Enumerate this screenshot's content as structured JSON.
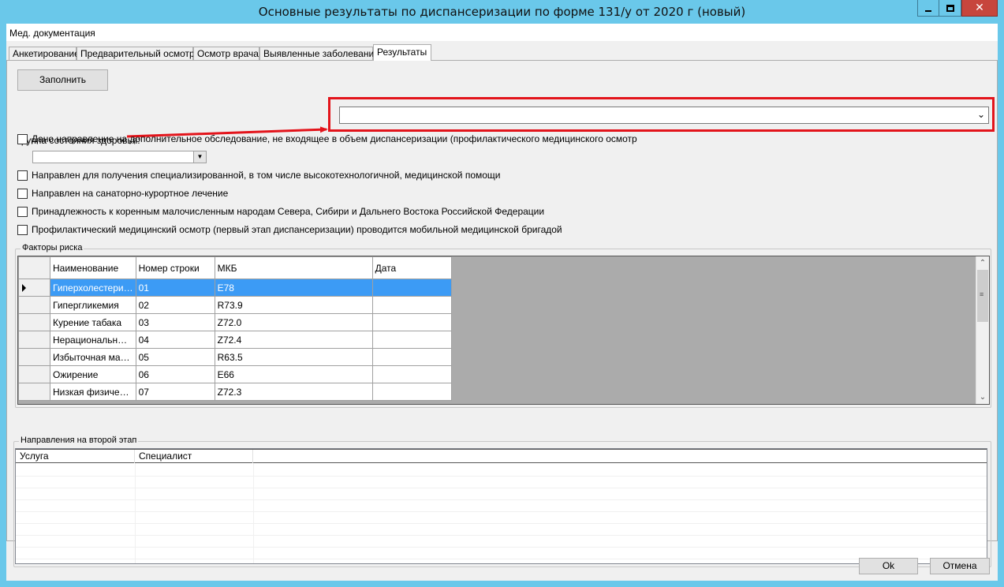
{
  "window": {
    "title": "Основные результаты по диспансеризации по форме 131/у от 2020 г (новый)",
    "close_glyph": "✕"
  },
  "menu": {
    "item": "Мед. документация"
  },
  "tabs": [
    {
      "label": "Анкетирование"
    },
    {
      "label": "Предварительный осмотр"
    },
    {
      "label": "Осмотр врача"
    },
    {
      "label": "Выявленные заболевания"
    },
    {
      "label": "Результаты"
    }
  ],
  "active_tab": "Результаты",
  "fill_button": "Заполнить",
  "health_group": {
    "label": "Группа состояния здоровья:",
    "value": ""
  },
  "checkboxes": {
    "additional_exam": "Дано направление на дополнительное обследование, не входящее в объем диспансеризации (профилактического медицинского осмотр",
    "specialized_care": "Направлен для получения специализированной, в том числе высокотехнологичной, медицинской помощи",
    "sanatorium": "Направлен на санаторно-курортное лечение",
    "indigenous": "Принадлежность к коренным малочисленным народам Севера, Сибири и Дальнего Востока Российской Федерации",
    "mobile_team": "Профилактический медицинский осмотр (первый этап диспансеризации) проводится мобильной медицинской бригадой"
  },
  "risk_factors": {
    "title": "Факторы риска",
    "columns": {
      "name": "Наименование",
      "row_number": "Номер строки",
      "mkb": "МКБ",
      "date": "Дата"
    },
    "rows": [
      {
        "name": "Гиперхолестери…",
        "row_number": "01",
        "mkb": "E78",
        "date": ""
      },
      {
        "name": "Гипергликемия",
        "row_number": "02",
        "mkb": "R73.9",
        "date": ""
      },
      {
        "name": "Курение табака",
        "row_number": "03",
        "mkb": "Z72.0",
        "date": ""
      },
      {
        "name": "Нерациональн…",
        "row_number": "04",
        "mkb": "Z72.4",
        "date": ""
      },
      {
        "name": "Избыточная ма…",
        "row_number": "05",
        "mkb": "R63.5",
        "date": ""
      },
      {
        "name": "Ожирение",
        "row_number": "06",
        "mkb": "E66",
        "date": ""
      },
      {
        "name": "Низкая физиче…",
        "row_number": "07",
        "mkb": "Z72.3",
        "date": ""
      }
    ]
  },
  "second_stage": {
    "title": "Направления на второй этап",
    "columns": {
      "service": "Услуга",
      "specialist": "Специалист"
    }
  },
  "buttons": {
    "ok": "Ok",
    "cancel": "Отмена"
  },
  "colors": {
    "highlight": "#e3141b",
    "selection": "#3c9bf5",
    "titlebar": "#6ac8ea"
  }
}
